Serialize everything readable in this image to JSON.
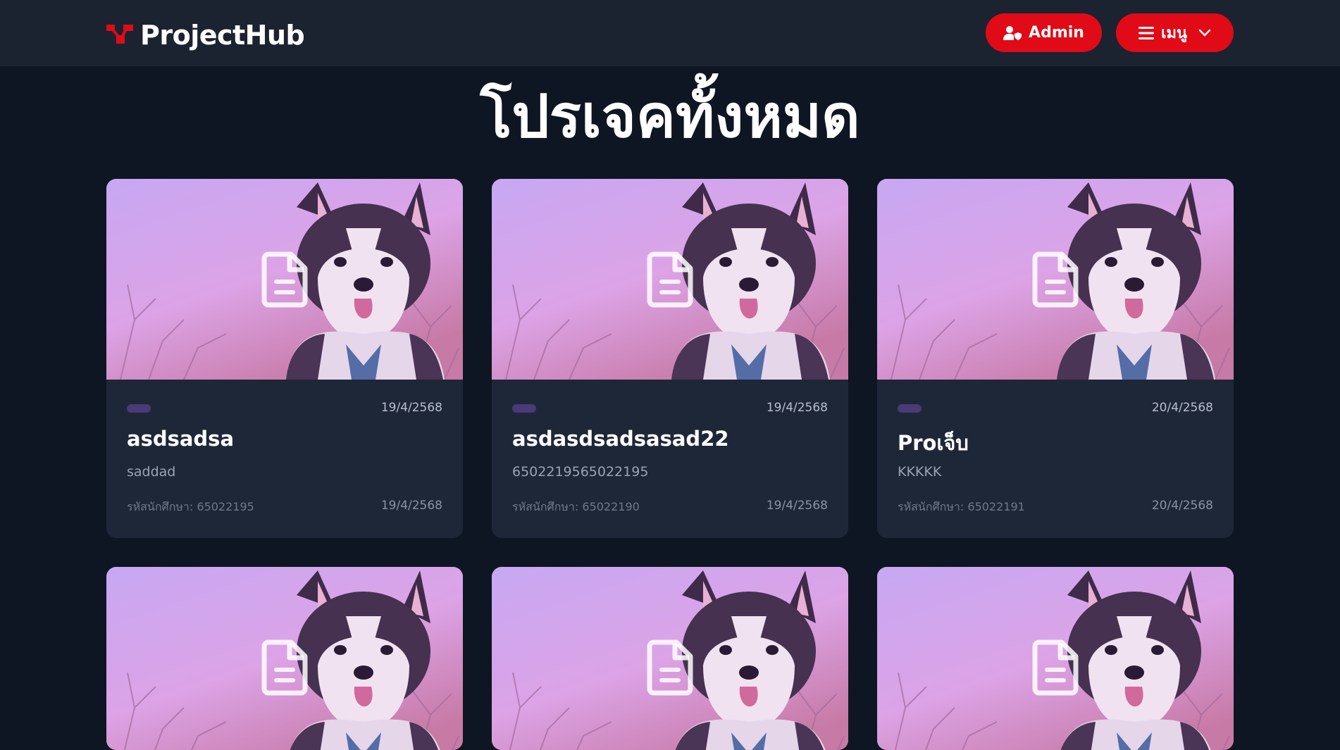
{
  "brand": {
    "name": "ProjectHub"
  },
  "nav": {
    "admin_label": "Admin",
    "menu_label": "เมนู"
  },
  "page": {
    "title": "โปรเจคทั้งหมด"
  },
  "colors": {
    "accent": "#e00b17",
    "background": "#0f1623",
    "card": "#1e2738",
    "navbar": "#1b2331"
  },
  "projects": [
    {
      "title": "asdsadsa",
      "description": "saddad",
      "student_id": "รหัสนักศึกษา: 65022195",
      "date_top": "19/4/2568",
      "date_bottom": "19/4/2568"
    },
    {
      "title": "asdasdsadsasad22",
      "description": "6502219565022195",
      "student_id": "รหัสนักศึกษา: 65022190",
      "date_top": "19/4/2568",
      "date_bottom": "19/4/2568"
    },
    {
      "title": "Proเจ็บ",
      "description": "KKKKK",
      "student_id": "รหัสนักศึกษา: 65022191",
      "date_top": "20/4/2568",
      "date_bottom": "20/4/2568"
    }
  ],
  "icons": {
    "logo": "projecthub-logo-icon",
    "admin": "user-shield-icon",
    "menu": "hamburger-icon",
    "chevron": "chevron-down-icon",
    "document": "document-icon"
  }
}
